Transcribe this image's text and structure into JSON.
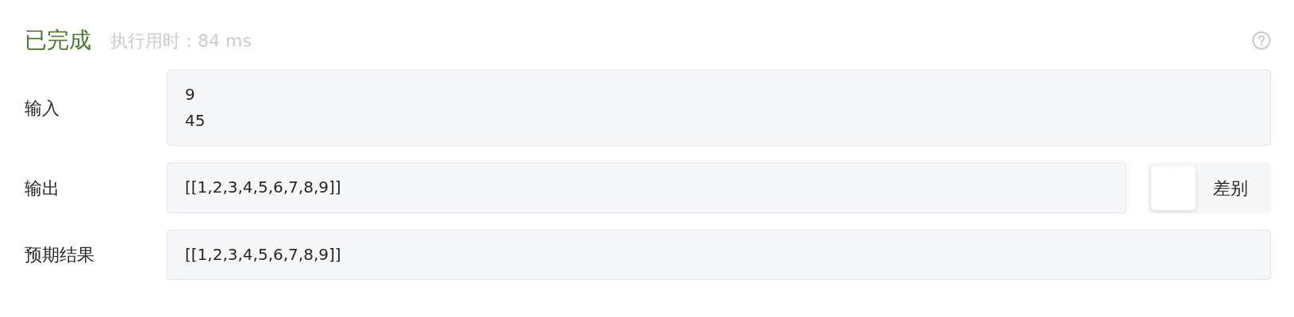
{
  "status": {
    "label": "已完成",
    "runtime": "执行用时：84 ms"
  },
  "fields": [
    {
      "label": "输入",
      "value": "9\n45"
    },
    {
      "label": "输出",
      "value": "[[1,2,3,4,5,6,7,8,9]]",
      "diff_toggle": {
        "label": "差别",
        "on": false
      }
    },
    {
      "label": "预期结果",
      "value": "[[1,2,3,4,5,6,7,8,9]]"
    }
  ]
}
